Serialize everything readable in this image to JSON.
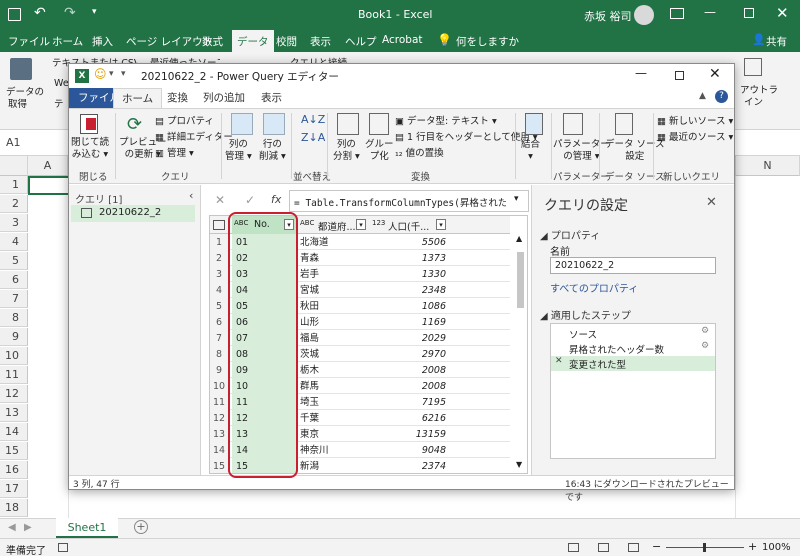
{
  "excel": {
    "window_title": "Book1  -  Excel",
    "user_name": "赤坂 裕司",
    "tabs": [
      "ファイル",
      "ホーム",
      "挿入",
      "ページ レイアウト",
      "数式",
      "データ",
      "校閲",
      "表示",
      "ヘルプ",
      "Acrobat"
    ],
    "tell_me": "何をしますか",
    "share": "共有",
    "ribbon_text": {
      "get_data_l1": "データの",
      "get_data_l2": "取得",
      "from_text_csv": "テキストまたは CSV から",
      "recent_sources": "最近使ったソース",
      "query_conn": "クエリと接続",
      "web_frag": "We",
      "table_frag": "テ",
      "outline_l1": "アウトラ",
      "outline_l2": "イン"
    },
    "name_box": "A1",
    "columns": [
      "A",
      "N"
    ],
    "rows": [
      "1",
      "2",
      "3",
      "4",
      "5",
      "6",
      "7",
      "8",
      "9",
      "10",
      "11",
      "12",
      "13",
      "14",
      "15",
      "16",
      "17",
      "18"
    ],
    "sheet_tab": "Sheet1",
    "status_ready": "準備完了",
    "zoom": "100%"
  },
  "pq": {
    "title": "20210622_2 - Power Query エディター",
    "tabs": [
      "ファイル",
      "ホーム",
      "変換",
      "列の追加",
      "表示"
    ],
    "ribbon": {
      "close_load_l1": "閉じて読",
      "close_load_l2": "み込む",
      "refresh_l1": "プレビュー",
      "refresh_l2": "の更新",
      "properties": "プロパティ",
      "advanced_editor": "詳細エディター",
      "manage": "管理",
      "manage_columns_l1": "列の",
      "manage_columns_l2": "管理",
      "reduce_rows_l1": "行の",
      "reduce_rows_l2": "削減",
      "split_column_l1": "列の",
      "split_column_l2": "分割",
      "group_by_l1": "グルー",
      "group_by_l2": "プ化",
      "data_type": "データ型: テキスト",
      "first_row_headers": "1 行目をヘッダーとして使用",
      "replace_values": "値の置換",
      "combine": "結合",
      "parameters_l1": "パラメーター",
      "parameters_l2": "の管理",
      "data_source_l1": "データ ソース",
      "data_source_l2": "設定",
      "new_source": "新しいソース",
      "recent_sources": "最近のソース",
      "group_close": "閉じる",
      "group_query": "クエリ",
      "group_sort": "並べ替え",
      "group_transform": "変換",
      "group_params": "パラメーター",
      "group_ds": "データ ソース",
      "group_new_query": "新しいクエリ"
    },
    "queries_header": "クエリ [1]",
    "query_item": "20210622_2",
    "formula": "= Table.TransformColumnTypes(昇格された",
    "columns": [
      {
        "type": "ABC",
        "name": "No."
      },
      {
        "type": "ABC",
        "name": "都道府..."
      },
      {
        "type": "123",
        "name": "人口(千..."
      }
    ],
    "rows": [
      {
        "i": "1",
        "no": "01",
        "pref": "北海道",
        "pop": "5506"
      },
      {
        "i": "2",
        "no": "02",
        "pref": "青森",
        "pop": "1373"
      },
      {
        "i": "3",
        "no": "03",
        "pref": "岩手",
        "pop": "1330"
      },
      {
        "i": "4",
        "no": "04",
        "pref": "宮城",
        "pop": "2348"
      },
      {
        "i": "5",
        "no": "05",
        "pref": "秋田",
        "pop": "1086"
      },
      {
        "i": "6",
        "no": "06",
        "pref": "山形",
        "pop": "1169"
      },
      {
        "i": "7",
        "no": "07",
        "pref": "福島",
        "pop": "2029"
      },
      {
        "i": "8",
        "no": "08",
        "pref": "茨城",
        "pop": "2970"
      },
      {
        "i": "9",
        "no": "09",
        "pref": "栃木",
        "pop": "2008"
      },
      {
        "i": "10",
        "no": "10",
        "pref": "群馬",
        "pop": "2008"
      },
      {
        "i": "11",
        "no": "11",
        "pref": "埼玉",
        "pop": "7195"
      },
      {
        "i": "12",
        "no": "12",
        "pref": "千葉",
        "pop": "6216"
      },
      {
        "i": "13",
        "no": "13",
        "pref": "東京",
        "pop": "13159"
      },
      {
        "i": "14",
        "no": "14",
        "pref": "神奈川",
        "pop": "9048"
      },
      {
        "i": "15",
        "no": "15",
        "pref": "新潟",
        "pop": "2374"
      }
    ],
    "settings": {
      "title": "クエリの設定",
      "properties_header": "プロパティ",
      "name_label": "名前",
      "name_value": "20210622_2",
      "all_properties": "すべてのプロパティ",
      "steps_header": "適用したステップ",
      "steps": [
        "ソース",
        "昇格されたヘッダー数",
        "変更された型"
      ]
    },
    "status_left": "3 列, 47 行",
    "status_right": "16:43 にダウンロードされたプレビューです"
  },
  "colors": {
    "excel_green": "#217346",
    "pq_blue": "#2b579a",
    "highlight": "#c8202f",
    "selected_col": "#d8eedb"
  }
}
